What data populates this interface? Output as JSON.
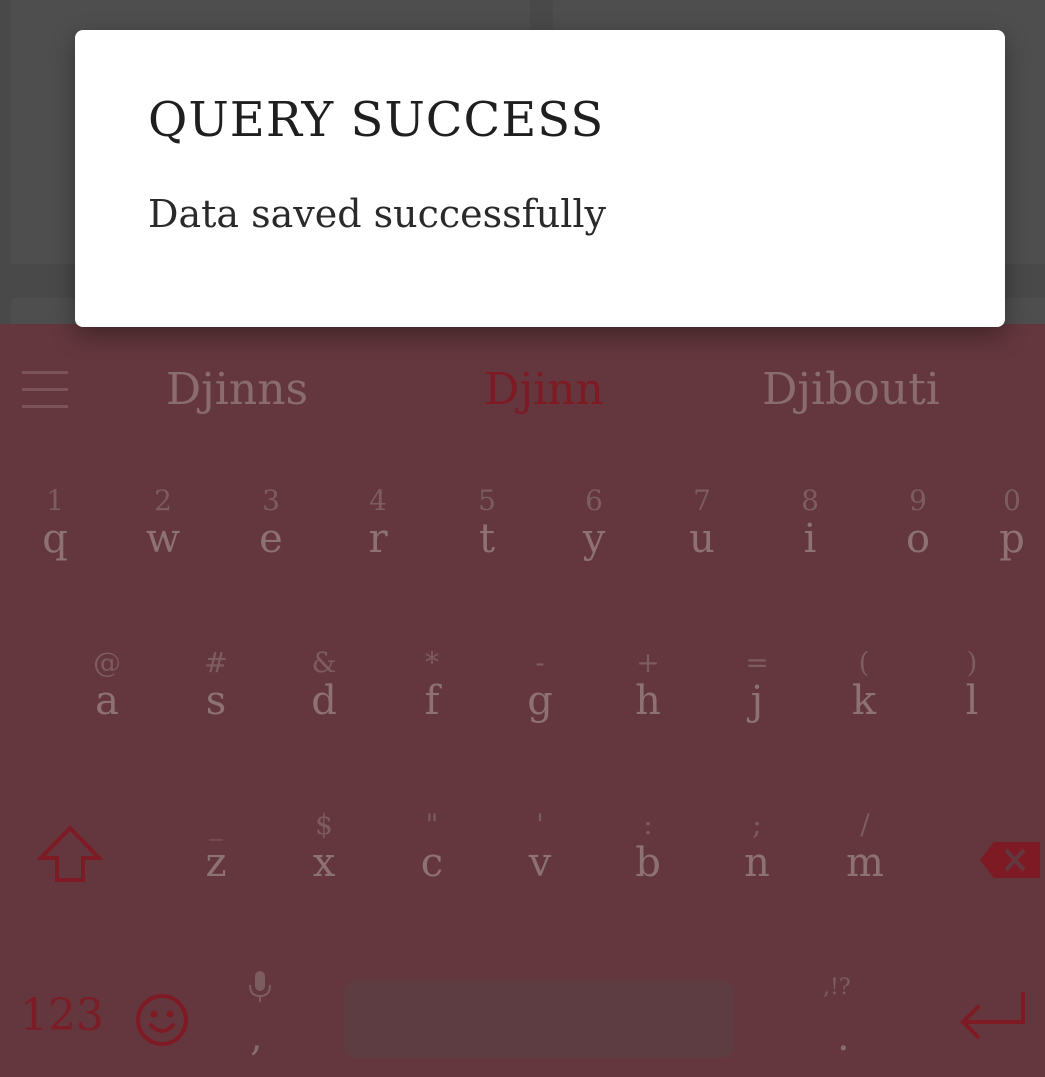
{
  "dialog": {
    "title": "QUERY SUCCESS",
    "message": "Data saved successfully"
  },
  "keyboard": {
    "suggestions": [
      "Djinns",
      "Djinn",
      "Djibouti"
    ],
    "row1": [
      {
        "hint": "1",
        "key": "q"
      },
      {
        "hint": "2",
        "key": "w"
      },
      {
        "hint": "3",
        "key": "e"
      },
      {
        "hint": "4",
        "key": "r"
      },
      {
        "hint": "5",
        "key": "t"
      },
      {
        "hint": "6",
        "key": "y"
      },
      {
        "hint": "7",
        "key": "u"
      },
      {
        "hint": "8",
        "key": "i"
      },
      {
        "hint": "9",
        "key": "o"
      },
      {
        "hint": "0",
        "key": "p"
      }
    ],
    "row2": [
      {
        "hint": "@",
        "key": "a"
      },
      {
        "hint": "#",
        "key": "s"
      },
      {
        "hint": "&",
        "key": "d"
      },
      {
        "hint": "*",
        "key": "f"
      },
      {
        "hint": "-",
        "key": "g"
      },
      {
        "hint": "+",
        "key": "h"
      },
      {
        "hint": "=",
        "key": "j"
      },
      {
        "hint": "(",
        "key": "k"
      },
      {
        "hint": ")",
        "key": "l"
      }
    ],
    "row3": [
      {
        "hint": "_",
        "key": "z"
      },
      {
        "hint": "$",
        "key": "x"
      },
      {
        "hint": "\"",
        "key": "c"
      },
      {
        "hint": "'",
        "key": "v"
      },
      {
        "hint": ":",
        "key": "b"
      },
      {
        "hint": ";",
        "key": "n"
      },
      {
        "hint": "/",
        "key": "m"
      }
    ],
    "num_key": "123",
    "comma": ",",
    "period_hint": ",!?",
    "period": "."
  },
  "colors": {
    "accent": "#7e1a24",
    "keyboard_bg": "#63373d",
    "key_text": "#8d7174"
  },
  "icons": {
    "menu": "menu-icon",
    "shift": "shift-arrow-icon",
    "delete": "backspace-icon",
    "emoji": "smiley-icon",
    "mic": "microphone-icon",
    "enter": "enter-return-icon"
  }
}
